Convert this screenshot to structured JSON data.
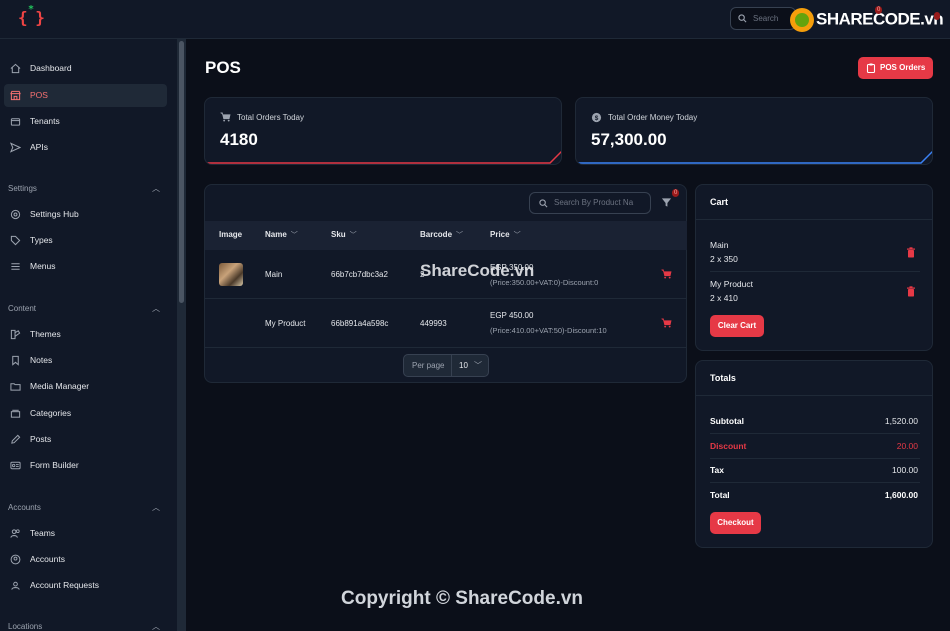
{
  "topbar": {
    "logo_text": "{ }",
    "search_placeholder": "Search",
    "notification_count": "0",
    "watermark": "SHARECODE.vn"
  },
  "sidebar": {
    "items": [
      {
        "label": "Dashboard",
        "icon": "home-icon"
      },
      {
        "label": "POS",
        "icon": "store-icon",
        "active": true
      },
      {
        "label": "Tenants",
        "icon": "layers-icon"
      },
      {
        "label": "APIs",
        "icon": "send-icon"
      }
    ],
    "sections": [
      {
        "title": "Settings",
        "items": [
          {
            "label": "Settings Hub",
            "icon": "gear-icon"
          },
          {
            "label": "Types",
            "icon": "tag-icon"
          },
          {
            "label": "Menus",
            "icon": "menu-icon"
          }
        ]
      },
      {
        "title": "Content",
        "items": [
          {
            "label": "Themes",
            "icon": "palette-icon"
          },
          {
            "label": "Notes",
            "icon": "bookmark-icon"
          },
          {
            "label": "Media Manager",
            "icon": "folder-icon"
          },
          {
            "label": "Categories",
            "icon": "stack-icon"
          },
          {
            "label": "Posts",
            "icon": "pencil-icon"
          },
          {
            "label": "Form Builder",
            "icon": "id-card-icon"
          }
        ]
      },
      {
        "title": "Accounts",
        "items": [
          {
            "label": "Teams",
            "icon": "users-icon"
          },
          {
            "label": "Accounts",
            "icon": "user-circle-icon"
          },
          {
            "label": "Account Requests",
            "icon": "user-request-icon"
          }
        ]
      },
      {
        "title": "Locations",
        "items": []
      }
    ]
  },
  "page": {
    "title": "POS",
    "pos_orders_label": "POS Orders"
  },
  "stats": [
    {
      "label": "Total Orders Today",
      "value": "4180",
      "icon": "cart-icon",
      "accent": "#e63946"
    },
    {
      "label": "Total Order Money Today",
      "value": "57,300.00",
      "icon": "dollar-icon",
      "accent": "#3b82f6"
    }
  ],
  "products": {
    "search_placeholder": "Search By Product Na",
    "filter_count": "0",
    "columns": [
      "Image",
      "Name",
      "Sku",
      "Barcode",
      "Price"
    ],
    "rows": [
      {
        "name": "Main",
        "sku": "66b7cb7dbc3a2",
        "barcode": "2",
        "price": "EGP 350.00",
        "detail": "(Price:350.00+VAT:0)-Discount:0",
        "has_image": true
      },
      {
        "name": "My Product",
        "sku": "66b891a4a598c",
        "barcode": "449993",
        "price": "EGP 450.00",
        "detail": "(Price:410.00+VAT:50)-Discount:10",
        "has_image": false
      }
    ],
    "per_page_label": "Per page",
    "per_page_value": "10"
  },
  "cart": {
    "title": "Cart",
    "items": [
      {
        "name": "Main",
        "qty": "2 x 350"
      },
      {
        "name": "My Product",
        "qty": "2 x 410"
      }
    ],
    "clear_label": "Clear Cart"
  },
  "totals": {
    "title": "Totals",
    "subtotal_label": "Subtotal",
    "subtotal": "1,520.00",
    "discount_label": "Discount",
    "discount": "20.00",
    "tax_label": "Tax",
    "tax": "100.00",
    "total_label": "Total",
    "total": "1,600.00",
    "checkout_label": "Checkout"
  },
  "watermark": {
    "center": "ShareCode.vn",
    "copyright": "Copyright © ShareCode.vn"
  },
  "colors": {
    "accent_red": "#e63946",
    "accent_blue": "#3b82f6",
    "background": "#0b0f19",
    "panel": "#111827"
  }
}
